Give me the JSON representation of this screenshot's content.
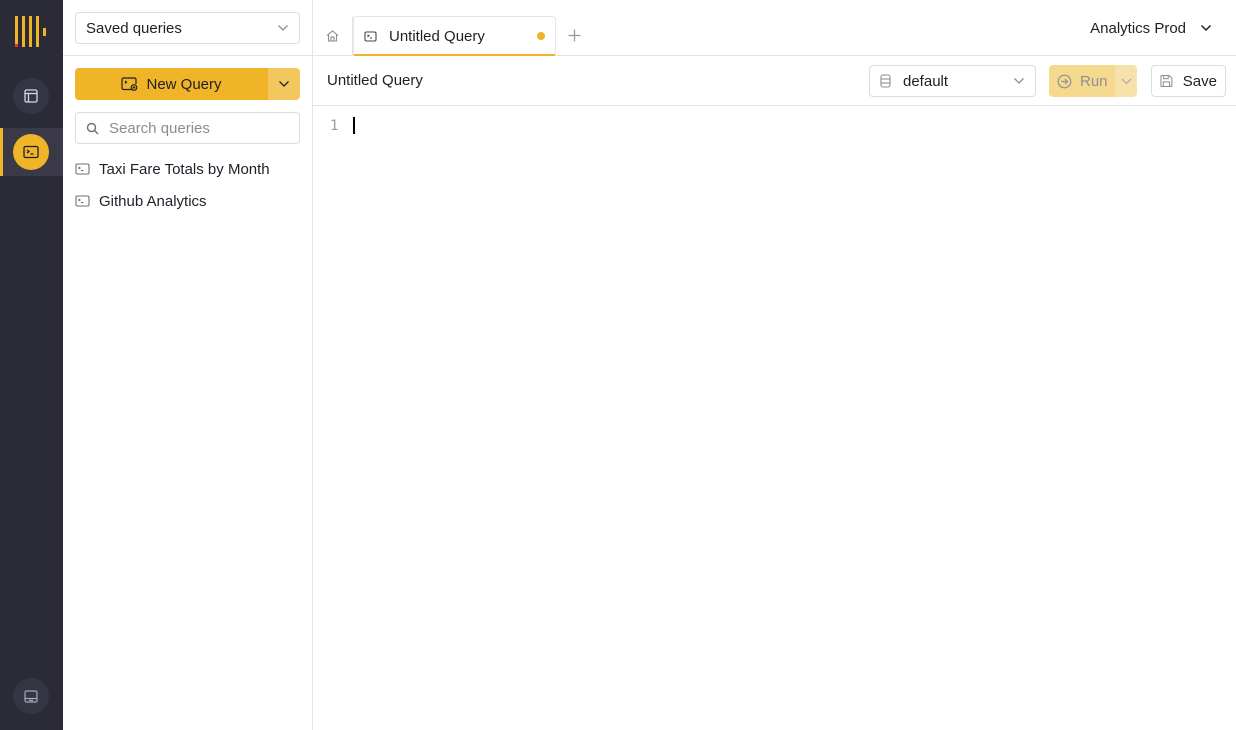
{
  "rail": {
    "logo": "clickhouse-logo",
    "items": [
      {
        "icon": "layout-icon",
        "label": "Tables",
        "active": false
      },
      {
        "icon": "terminal-icon",
        "label": "Queries",
        "active": true
      }
    ],
    "bottom_icon": "panel-icon"
  },
  "sidebar": {
    "view_select": "Saved queries",
    "new_query_label": "New Query",
    "search": {
      "placeholder": "Search queries",
      "value": ""
    },
    "queries": [
      {
        "label": "Taxi Fare Totals by Month"
      },
      {
        "label": "Github Analytics"
      }
    ]
  },
  "tabs": {
    "home_icon": "home-icon",
    "items": [
      {
        "label": "Untitled Query",
        "unsaved": true,
        "active": true
      }
    ],
    "add_label": "+"
  },
  "service": {
    "name": "Analytics Prod"
  },
  "toolbar": {
    "query_title": "Untitled Query",
    "database": "default",
    "run_label": "Run",
    "save_label": "Save"
  },
  "editor": {
    "line_numbers": [
      "1"
    ],
    "content": ""
  },
  "colors": {
    "accent": "#f0b429",
    "rail_bg": "#2b2a37",
    "logo_red": "#e5362c"
  }
}
